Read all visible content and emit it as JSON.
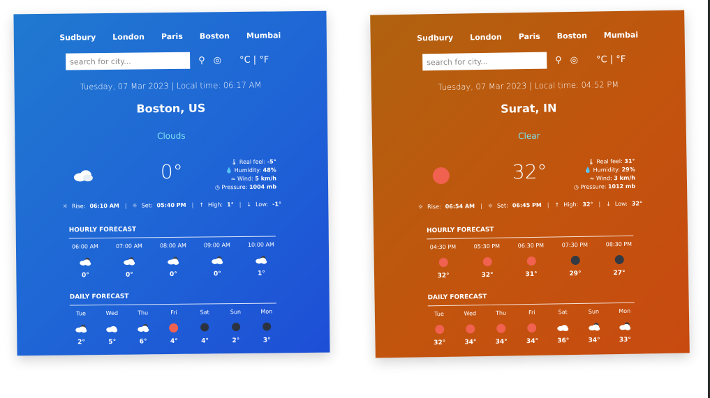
{
  "cards": [
    {
      "cities": [
        "Sudbury",
        "London",
        "Paris",
        "Boston",
        "Mumbai"
      ],
      "search_placeholder": "search for city...",
      "units": {
        "c": "°C",
        "sep": "|",
        "f": "°F"
      },
      "datetime": "Tuesday, 07 Mar 2023 | Local time: 06:17 AM",
      "city": "Boston, US",
      "condition": "Clouds",
      "temp": "0°",
      "details": {
        "real_feel_label": "Real feel:",
        "real_feel": "-5°",
        "humidity_label": "Humidity:",
        "humidity": "48%",
        "wind_label": "Wind:",
        "wind": "5 km/h",
        "pressure_label": "Pressure:",
        "pressure": "1004 mb"
      },
      "sun": {
        "rise_label": "Rise:",
        "rise": "06:10 AM",
        "set_label": "Set:",
        "set": "05:40 PM",
        "high_label": "High:",
        "high": "1°",
        "low_label": "Low:",
        "low": "-1°"
      },
      "hourly_title": "HOURLY FORECAST",
      "hourly": [
        {
          "label": "06:00 AM",
          "temp": "0°",
          "icon": "cloud-sun"
        },
        {
          "label": "07:00 AM",
          "temp": "0°",
          "icon": "cloud-sun"
        },
        {
          "label": "08:00 AM",
          "temp": "0°",
          "icon": "cloud-sun"
        },
        {
          "label": "09:00 AM",
          "temp": "0°",
          "icon": "cloud-sun"
        },
        {
          "label": "10:00 AM",
          "temp": "1°",
          "icon": "cloud-sun"
        }
      ],
      "daily_title": "DAILY FORECAST",
      "daily": [
        {
          "label": "Tue",
          "temp": "2°",
          "icon": "cloud-sun"
        },
        {
          "label": "Wed",
          "temp": "5°",
          "icon": "cloud"
        },
        {
          "label": "Thu",
          "temp": "6°",
          "icon": "cloud-sun"
        },
        {
          "label": "Fri",
          "temp": "4°",
          "icon": "sun"
        },
        {
          "label": "Sat",
          "temp": "4°",
          "icon": "dark"
        },
        {
          "label": "Sun",
          "temp": "2°",
          "icon": "dark"
        },
        {
          "label": "Mon",
          "temp": "3°",
          "icon": "dark"
        }
      ]
    },
    {
      "cities": [
        "Sudbury",
        "London",
        "Paris",
        "Boston",
        "Mumbai"
      ],
      "search_placeholder": "search for city...",
      "units": {
        "c": "°C",
        "sep": "|",
        "f": "°F"
      },
      "datetime": "Tuesday, 07 Mar 2023 | Local time: 04:52 PM",
      "city": "Surat, IN",
      "condition": "Clear",
      "temp": "32°",
      "details": {
        "real_feel_label": "Real feel:",
        "real_feel": "31°",
        "humidity_label": "Humidity:",
        "humidity": "29%",
        "wind_label": "Wind:",
        "wind": "3 km/h",
        "pressure_label": "Pressure:",
        "pressure": "1012 mb"
      },
      "sun": {
        "rise_label": "Rise:",
        "rise": "06:54 AM",
        "set_label": "Set:",
        "set": "06:45 PM",
        "high_label": "High:",
        "high": "32°",
        "low_label": "Low:",
        "low": "32°"
      },
      "hourly_title": "HOURLY FORECAST",
      "hourly": [
        {
          "label": "04:30 PM",
          "temp": "32°",
          "icon": "sun"
        },
        {
          "label": "05:30 PM",
          "temp": "32°",
          "icon": "sun"
        },
        {
          "label": "06:30 PM",
          "temp": "31°",
          "icon": "sun"
        },
        {
          "label": "07:30 PM",
          "temp": "29°",
          "icon": "moon"
        },
        {
          "label": "08:30 PM",
          "temp": "27°",
          "icon": "moon"
        }
      ],
      "daily_title": "DAILY FORECAST",
      "daily": [
        {
          "label": "Tue",
          "temp": "32°",
          "icon": "sun"
        },
        {
          "label": "Wed",
          "temp": "34°",
          "icon": "sun"
        },
        {
          "label": "Thu",
          "temp": "34°",
          "icon": "sun"
        },
        {
          "label": "Fri",
          "temp": "34°",
          "icon": "sun"
        },
        {
          "label": "Sat",
          "temp": "36°",
          "icon": "cloud"
        },
        {
          "label": "Sun",
          "temp": "34°",
          "icon": "cloud-sun"
        },
        {
          "label": "Mon",
          "temp": "33°",
          "icon": "cloud-sun"
        }
      ]
    }
  ],
  "colors": {
    "condition": "#7fe3f2",
    "sun": "#f0614f",
    "moon": "#333a44"
  }
}
